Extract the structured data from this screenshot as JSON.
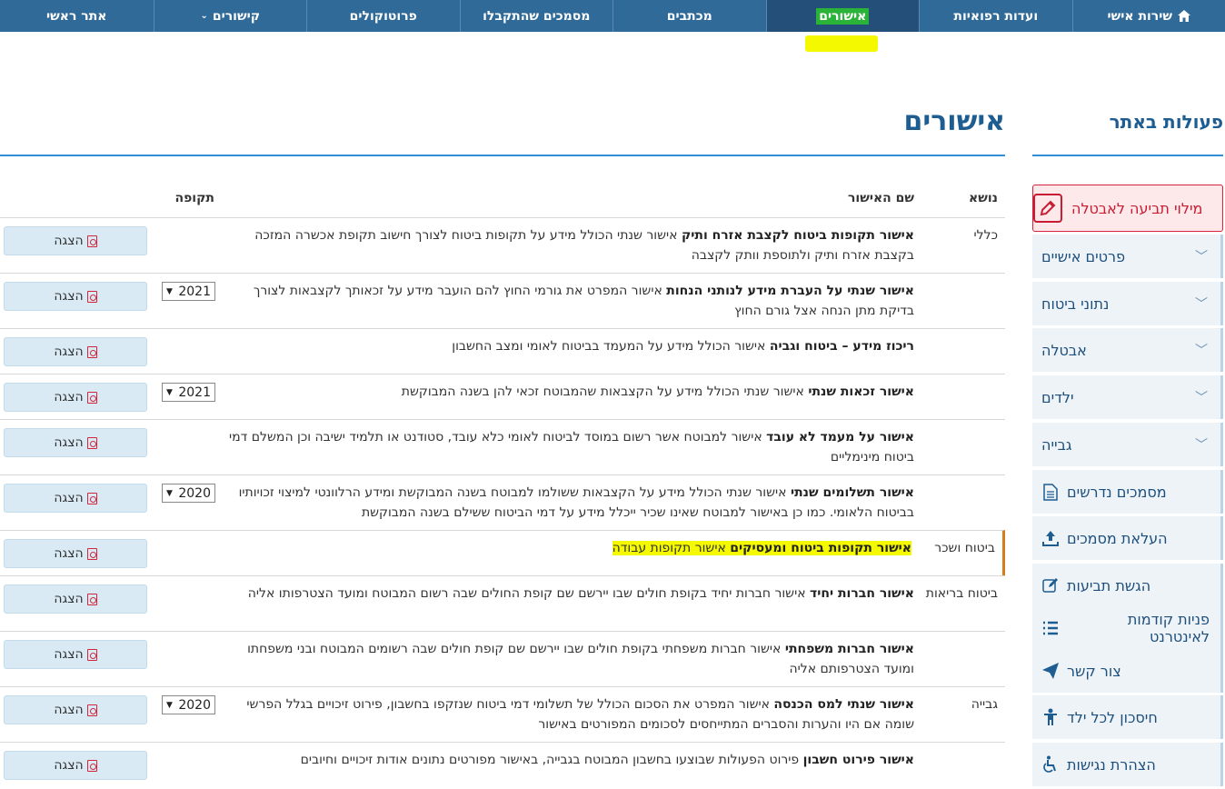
{
  "nav": {
    "items": [
      {
        "label": "שירות אישי",
        "icon": "home-icon"
      },
      {
        "label": "ועדות רפואיות"
      },
      {
        "label": "אישורים",
        "active": true
      },
      {
        "label": "מכתבים"
      },
      {
        "label": "מסמכים שהתקבלו"
      },
      {
        "label": "פרוטוקולים"
      },
      {
        "label": "קישורים",
        "icon": "chevron-down-icon"
      },
      {
        "label": "אתר ראשי"
      }
    ]
  },
  "sidebar": {
    "title": "פעולות באתר",
    "cta": "מילוי תביעה לאבטלה",
    "collapsibles": [
      "פרטים אישיים",
      "נתוני ביטוח",
      "אבטלה",
      "ילדים",
      "גבייה"
    ],
    "links": [
      {
        "label": "מסמכים נדרשים",
        "icon": "document-icon"
      },
      {
        "label": "העלאת מסמכים",
        "icon": "upload-icon"
      },
      {
        "label": "הגשת תביעות",
        "icon": "edit-icon"
      },
      {
        "label": "פניות קודמות לאינטרנט",
        "icon": "list-icon"
      },
      {
        "label": "צור קשר",
        "icon": "send-icon"
      },
      {
        "label": "חיסכון לכל ילד",
        "icon": "child-icon"
      },
      {
        "label": "הצהרת נגישות",
        "icon": "accessibility-icon"
      }
    ]
  },
  "main": {
    "title": "אישורים",
    "headers": {
      "topic": "נושא",
      "name": "שם האישור",
      "period": "תקופה"
    },
    "show_label": "הצגה",
    "rows": [
      {
        "topic": "כללי",
        "bold": "אישור תקופות ביטוח לקצבת אזרח ותיק",
        "text": " אישור שנתי הכולל מידע על תקופות ביטוח לצורך חישוב תקופת אכשרה המזכה בקצבת אזרח ותיק ולתוספת וותק לקצבה",
        "period": ""
      },
      {
        "topic": "",
        "bold": "אישור שנתי על העברת מידע לנותני הנחות",
        "text": " אישור המפרט את גורמי החוץ להם הועבר מידע על זכאותך לקצבאות לצורך בדיקת מתן הנחה אצל גורם החוץ",
        "period": "2021"
      },
      {
        "topic": "",
        "bold": "ריכוז מידע – ביטוח וגביה",
        "text": " אישור הכולל מידע על המעמד בביטוח לאומי ומצב החשבון",
        "period": ""
      },
      {
        "topic": "",
        "bold": "אישור זכאות שנתי",
        "text": " אישור שנתי הכולל מידע על הקצבאות שהמבוטח זכאי להן בשנה המבוקשת",
        "period": "2021"
      },
      {
        "topic": "",
        "bold": "אישור על מעמד לא עובד",
        "text": " אישור למבוטח אשר רשום במוסד לביטוח לאומי כלא עובד, סטודנט או תלמיד ישיבה וכן המשלם דמי ביטוח מינימליים",
        "period": ""
      },
      {
        "topic": "",
        "bold": "אישור תשלומים שנתי",
        "text": " אישור שנתי הכולל מידע על הקצבאות ששולמו למבוטח בשנה המבוקשת ומידע הרלוונטי למיצוי זכויותיו בביטוח הלאומי. כמו כן באישור למבוטח שאינו שכיר ייכלל מידע על דמי הביטוח ששילם בשנה המבוקשת",
        "period": "2020"
      },
      {
        "topic": "ביטוח ושכר",
        "bold": "אישור תקופות ביטוח ומעסיקים",
        "text": " אישור תקופות עבודה",
        "period": "",
        "highlight": true
      },
      {
        "topic": "ביטוח בריאות",
        "bold": "אישור חברות יחיד",
        "text": " אישור חברות יחיד בקופת חולים שבו יירשם שם קופת החולים שבה רשום המבוטח ומועד הצטרפותו אליה",
        "period": ""
      },
      {
        "topic": "",
        "bold": "אישור חברות משפחתי",
        "text": " אישור חברות משפחתי בקופת חולים שבו יירשם שם קופת חולים שבה רשומים המבוטח ובני משפחתו ומועד הצטרפותם אליה",
        "period": ""
      },
      {
        "topic": "גבייה",
        "bold": "אישור שנתי למס הכנסה",
        "text": " אישור המפרט את הסכום הכולל של תשלומי דמי ביטוח שנזקפו בחשבון, פירוט זיכויים בגלל הפרשי שומה אם היו והערות והסברים המתייחסים לסכומים המפורטים באישור",
        "period": "2020"
      },
      {
        "topic": "",
        "bold": "אישור פירוט חשבון",
        "text": " פירוט הפעולות שבוצעו בחשבון המבוטח בגבייה, באישור מפורטים נתונים אודות זיכויים וחיובים",
        "period": ""
      }
    ]
  },
  "colors": {
    "nav": "#2f6a99",
    "accent": "#1d5d91",
    "danger": "#c81c33",
    "highlight": "#f4f900"
  }
}
